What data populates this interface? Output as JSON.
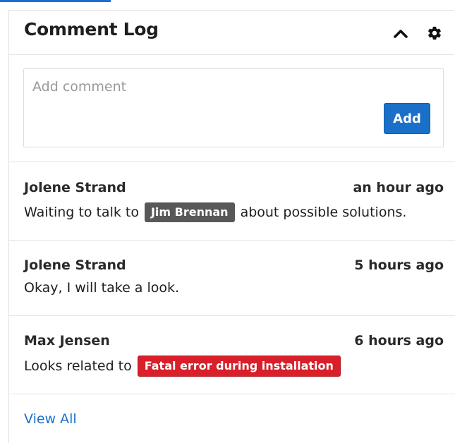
{
  "dashlet": {
    "title": "Comment Log"
  },
  "compose": {
    "placeholder": "Add comment",
    "value": "",
    "add_label": "Add"
  },
  "comments": [
    {
      "author": "Jolene Strand",
      "time": "an hour ago",
      "text_before": "Waiting to talk to",
      "tag": "Jim Brennan",
      "tag_type": "user",
      "text_after": "about possible solutions."
    },
    {
      "author": "Jolene Strand",
      "time": "5 hours ago",
      "text_before": "Okay, I will take a look.",
      "tag": "",
      "tag_type": "",
      "text_after": ""
    },
    {
      "author": "Max Jensen",
      "time": "6 hours ago",
      "text_before": "Looks related to",
      "tag": "Fatal error during installation",
      "tag_type": "bug",
      "text_after": ""
    }
  ],
  "footer": {
    "view_all_label": "View All"
  },
  "colors": {
    "accent": "#1a6fc9",
    "user_tag": "#585858",
    "bug_tag": "#d91f2a"
  },
  "icons": {
    "collapse": "chevron-up-icon",
    "settings": "gear-icon"
  }
}
